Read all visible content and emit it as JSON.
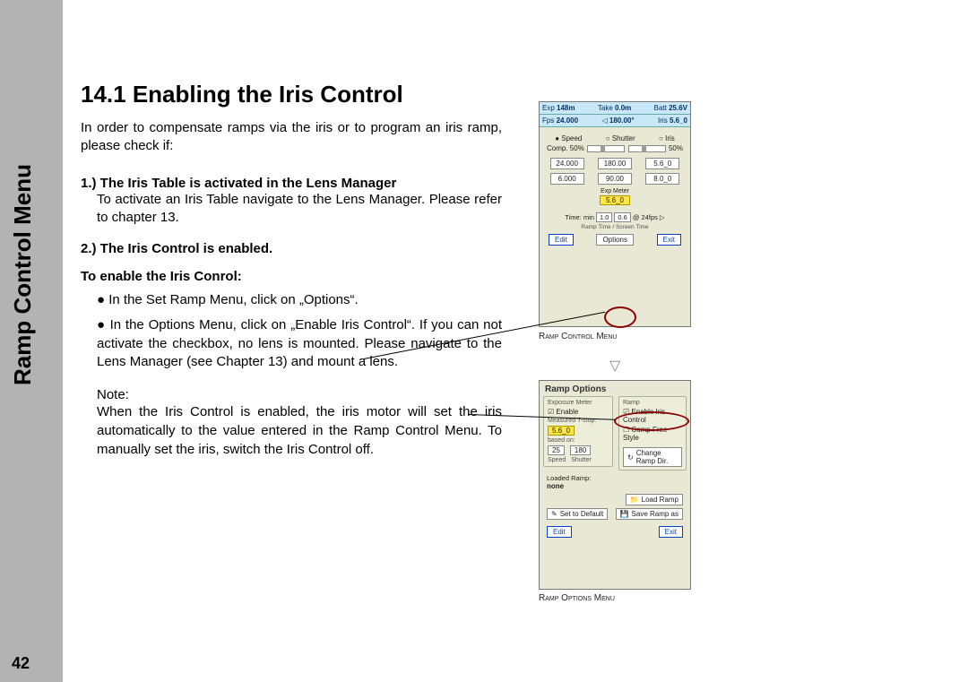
{
  "sidebar": {
    "label": "Ramp Control Menu"
  },
  "page_number": "42",
  "heading": "14.1 Enabling the Iris Control",
  "intro": "In order to compensate ramps via the iris or to program an iris ramp, please check if:",
  "step1_head": "1.) The Iris Table is activated in the Lens Manager",
  "step1_body": "To activate an Iris Table navigate to the Lens Manager. Please refer to chapter 13.",
  "step2_head": "2.) The Iris Control is enabled.",
  "sub_head": "To enable the Iris Conrol:",
  "bullet1": "In the Set Ramp Menu, click on „Options“.",
  "bullet2": "In the Options Menu, click on „Enable Iris Control“. If you can not activate the checkbox, no lens is mounted. Please navigate to the Lens Manager (see Chapter 13) and mount a lens.",
  "note_label": "Note:",
  "note_body": "When the Iris Control is enabled, the iris motor will set the iris automatically to the value entered in the Ramp Control Menu. To manually set the iris, switch the Iris Control off.",
  "shot1": {
    "caption": "Ramp Control Menu",
    "top1": {
      "exp": "Exp",
      "exp_v": "148m",
      "take": "Take",
      "take_v": "0.0m",
      "batt": "Batt",
      "batt_v": "25.6V"
    },
    "top2": {
      "fps": "Fps",
      "fps_v": "24.000",
      "ang_icon": "◁",
      "ang_v": "180.00°",
      "iris": "Iris",
      "iris_v": "5.6_0"
    },
    "radios": {
      "speed": "Speed",
      "shutter": "Shutter",
      "iris": "Iris"
    },
    "comp": {
      "label_l": "Comp.",
      "val_l": "50%",
      "val_r": "50%"
    },
    "cols": {
      "speed": [
        "24.000",
        "6.000"
      ],
      "shutter": [
        "180.00",
        "90.00"
      ],
      "iris": [
        "5.6_0",
        "8.0_0"
      ]
    },
    "exp_meter_label": "Exp Meter",
    "exp_meter_value": "5.6_0",
    "time": {
      "label": "Time: min",
      "a": "1.0",
      "b": "0.6",
      "fps": "@ 24fps",
      "icon": "▷"
    },
    "ramp_time_screen": "Ramp Time / Screen Time",
    "buttons": {
      "edit": "Edit",
      "options": "Options",
      "exit": "Exit"
    }
  },
  "shot2": {
    "caption": "Ramp Options Menu",
    "title": "Ramp Options",
    "left_group_title": "Exposure Meter",
    "left_enable": "Enable",
    "measured": "Measured T-stop:",
    "tstop": "5.6_0",
    "based": "based on:",
    "nums": {
      "speed": "25",
      "shutter": "180"
    },
    "num_labels": {
      "speed": "Speed",
      "shutter": "Shutter"
    },
    "right_group_title": "Ramp",
    "enable_iris": "Enable Iris Control",
    "comp_free": "Comp Free Style",
    "change_dir": "Change Ramp Dir.",
    "ramp_icon": "↻",
    "loaded_label": "Loaded Ramp:",
    "loaded_value": "none",
    "load_ramp": "Load Ramp",
    "load_icon": "📁",
    "set_default": "Set to Default",
    "def_icon": "✎",
    "save_as": "Save Ramp as",
    "save_icon": "💾",
    "footer": {
      "edit": "Edit",
      "exit": "Exit"
    }
  }
}
